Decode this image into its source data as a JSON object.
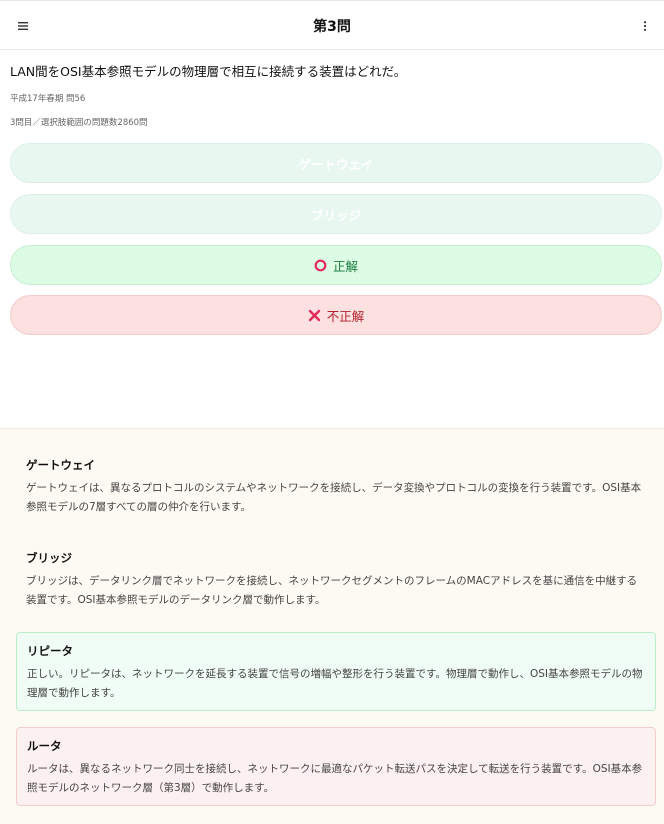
{
  "header": {
    "title": "第3問",
    "menu_icon": "hamburger-menu-icon",
    "more_icon": "vertical-dots-icon"
  },
  "question": {
    "text": "LAN間をOSI基本参照モデルの物理層で相互に接続する装置はどれだ。",
    "source": "平成17年春期 問56",
    "progress": "3問目／選択肢範囲の問題数2860問"
  },
  "choices": [
    {
      "label": "ゲートウェイ",
      "state": "disabled"
    },
    {
      "label": "ブリッジ",
      "state": "disabled"
    },
    {
      "label": "正解",
      "state": "correct",
      "icon": "circle-icon"
    },
    {
      "label": "不正解",
      "state": "wrong",
      "icon": "x-icon"
    }
  ],
  "explanations": [
    {
      "title": "ゲートウェイ",
      "body": "ゲートウェイは、異なるプロトコルのシステムやネットワークを接続し、データ変換やプロトコルの変換を行う装置です。OSI基本参照モデルの7層すべての層の仲介を行います。"
    },
    {
      "title": "ブリッジ",
      "body": "ブリッジは、データリンク層でネットワークを接続し、ネットワークセグメントのフレームのMACアドレスを基に通信を中継する装置です。OSI基本参照モデルのデータリンク層で動作します。"
    },
    {
      "title": "リピータ",
      "body": "正しい。リピータは、ネットワークを延長する装置で信号の増幅や整形を行う装置です。物理層で動作し、OSI基本参照モデルの物理層で動作します。",
      "state": "correct"
    },
    {
      "title": "ルータ",
      "body": "ルータは、異なるネットワーク同士を接続し、ネットワークに最適なパケット転送パスを決定して転送を行う装置です。OSI基本参照モデルのネットワーク層（第3層）で動作します。",
      "state": "wrong"
    }
  ],
  "colors": {
    "correct": "#dcfce6",
    "wrong": "#fde1e1",
    "disabled": "#e9f7f1",
    "explain_bg": "#fdfaf3"
  }
}
